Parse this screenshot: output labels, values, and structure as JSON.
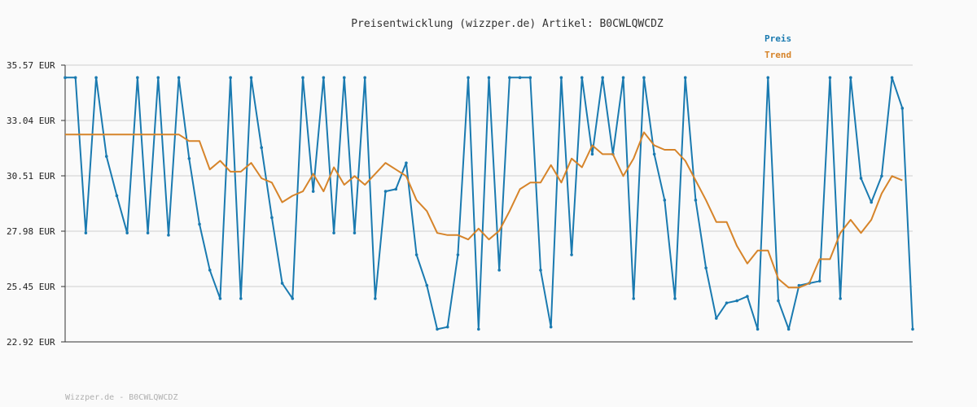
{
  "chart_data": {
    "type": "line",
    "title": "Preisentwicklung (wizzper.de) Artikel: B0CWLQWCDZ",
    "footer": "Wizzper.de - B0CWLQWCDZ",
    "yticks": [
      "35.57 EUR",
      "33.04 EUR",
      "30.51 EUR",
      "27.98 EUR",
      "25.45 EUR",
      "22.92 EUR"
    ],
    "ylim": [
      22.92,
      35.57
    ],
    "grid": true,
    "legend_position": "top-right",
    "series": [
      {
        "name": "Preis",
        "color": "#1a7ab0",
        "values": [
          35.0,
          35.0,
          27.9,
          35.0,
          31.4,
          29.6,
          27.9,
          35.0,
          27.9,
          35.0,
          27.8,
          35.0,
          31.3,
          28.3,
          26.2,
          24.9,
          35.0,
          24.9,
          35.0,
          31.8,
          28.6,
          25.6,
          24.9,
          35.0,
          29.8,
          35.0,
          27.9,
          35.0,
          27.9,
          35.0,
          24.9,
          29.8,
          29.9,
          31.1,
          26.9,
          25.5,
          23.5,
          23.6,
          26.9,
          35.0,
          23.5,
          35.0,
          26.2,
          35.0,
          35.0,
          35.0,
          26.2,
          23.6,
          35.0,
          26.9,
          35.0,
          31.5,
          35.0,
          31.5,
          35.0,
          24.9,
          35.0,
          31.5,
          29.4,
          24.9,
          35.0,
          29.4,
          26.3,
          24.0,
          24.7,
          24.8,
          25.0,
          23.5,
          35.0,
          24.8,
          23.5,
          25.5,
          25.6,
          25.7,
          35.0,
          24.9,
          35.0,
          30.4,
          29.3,
          30.5,
          35.0,
          33.6,
          23.5
        ]
      },
      {
        "name": "Trend",
        "color": "#d6842a",
        "values": [
          32.4,
          32.4,
          32.4,
          32.4,
          32.4,
          32.4,
          32.4,
          32.4,
          32.4,
          32.4,
          32.4,
          32.4,
          32.1,
          32.1,
          30.8,
          31.2,
          30.7,
          30.7,
          31.1,
          30.4,
          30.2,
          29.3,
          29.6,
          29.8,
          30.6,
          29.8,
          30.9,
          30.1,
          30.5,
          30.1,
          30.6,
          31.1,
          30.8,
          30.5,
          29.4,
          28.9,
          27.9,
          27.8,
          27.8,
          27.6,
          28.1,
          27.6,
          28.0,
          28.9,
          29.9,
          30.2,
          30.2,
          31.0,
          30.2,
          31.3,
          30.9,
          31.9,
          31.5,
          31.5,
          30.5,
          31.3,
          32.5,
          31.9,
          31.7,
          31.7,
          31.2,
          30.3,
          29.4,
          28.4,
          28.4,
          27.3,
          26.5,
          27.1,
          27.1,
          25.8,
          25.4,
          25.4,
          25.6,
          26.7,
          26.7,
          27.9,
          28.5,
          27.9,
          28.5,
          29.7,
          30.5,
          30.3
        ]
      }
    ]
  }
}
